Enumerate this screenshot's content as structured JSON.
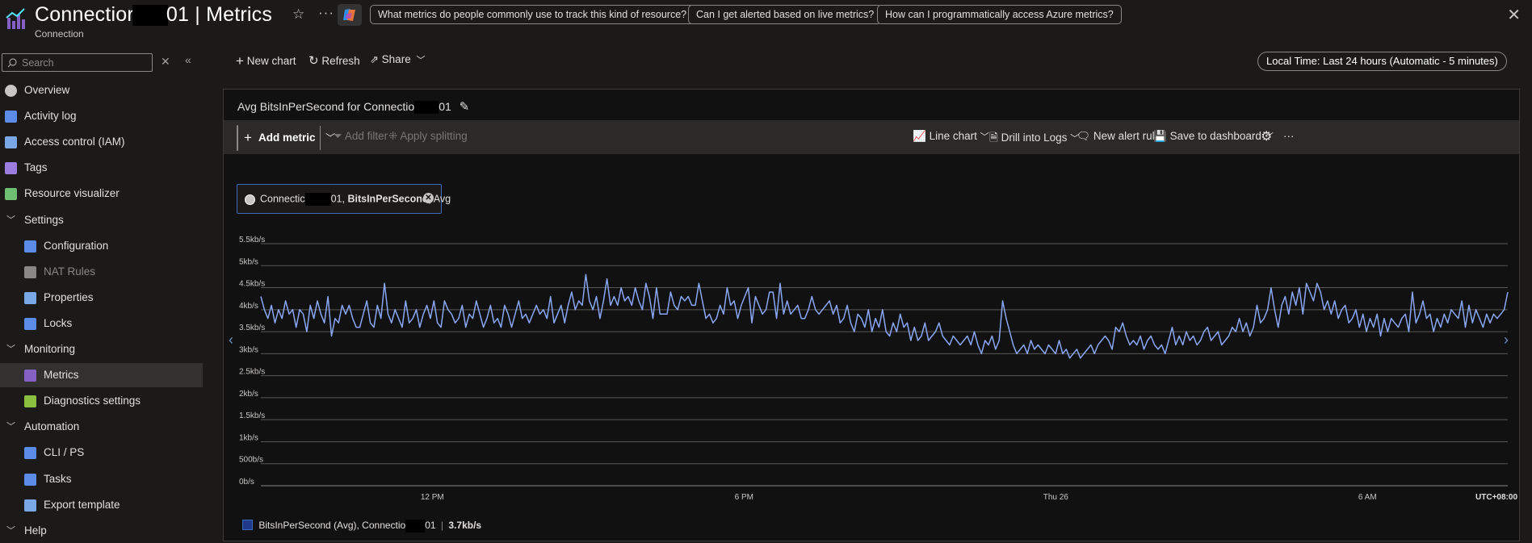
{
  "header": {
    "title_left": "Connectior",
    "title_right": "01 | Metrics",
    "subtitle": "Connection",
    "suggestions": [
      "What metrics do people commonly use to track this kind of resource?",
      "Can I get alerted based on live metrics?",
      "How can I programmatically access Azure metrics?"
    ]
  },
  "sidebar": {
    "search_placeholder": "Search",
    "items": [
      {
        "label": "Overview",
        "icon": "overview-icon",
        "level": 0
      },
      {
        "label": "Activity log",
        "icon": "activity-log-icon",
        "level": 0
      },
      {
        "label": "Access control (IAM)",
        "icon": "iam-icon",
        "level": 0
      },
      {
        "label": "Tags",
        "icon": "tag-icon",
        "level": 0
      },
      {
        "label": "Resource visualizer",
        "icon": "visualizer-icon",
        "level": 0
      },
      {
        "label": "Settings",
        "icon": "chevron-down-icon",
        "level": 0,
        "group": true
      },
      {
        "label": "Configuration",
        "icon": "configuration-icon",
        "level": 1
      },
      {
        "label": "NAT Rules",
        "icon": "nat-icon",
        "level": 1,
        "disabled": true
      },
      {
        "label": "Properties",
        "icon": "properties-icon",
        "level": 1
      },
      {
        "label": "Locks",
        "icon": "lock-icon",
        "level": 1
      },
      {
        "label": "Monitoring",
        "icon": "chevron-down-icon",
        "level": 0,
        "group": true
      },
      {
        "label": "Metrics",
        "icon": "metrics-icon",
        "level": 1,
        "selected": true
      },
      {
        "label": "Diagnostics settings",
        "icon": "diagnostics-icon",
        "level": 1
      },
      {
        "label": "Automation",
        "icon": "chevron-down-icon",
        "level": 0,
        "group": true
      },
      {
        "label": "CLI / PS",
        "icon": "cli-icon",
        "level": 1
      },
      {
        "label": "Tasks",
        "icon": "tasks-icon",
        "level": 1
      },
      {
        "label": "Export template",
        "icon": "export-icon",
        "level": 1
      },
      {
        "label": "Help",
        "icon": "chevron-down-icon",
        "level": 0,
        "group": true
      }
    ]
  },
  "toolbar": {
    "new_chart": "New chart",
    "refresh": "Refresh",
    "share": "Share",
    "time_range": "Local Time: Last 24 hours (Automatic - 5 minutes)"
  },
  "panel": {
    "title_left": "Avg BitsInPerSecond for Connectio",
    "title_right": "01",
    "add_metric": "Add metric",
    "add_filter": "Add filter",
    "apply_splitting": "Apply splitting",
    "line_chart": "Line chart",
    "drill_logs": "Drill into Logs",
    "new_alert": "New alert rule",
    "save_dashboard": "Save to dashboard",
    "pill_prefix": "Connectic",
    "pill_suffix": "01,",
    "pill_metric": "BitsInPerSecond,",
    "pill_agg": "Avg",
    "legend_prefix": "BitsInPerSecond (Avg), Connectio",
    "legend_suffix": "01",
    "legend_value": "3.7kb/s"
  },
  "chart_data": {
    "type": "line",
    "ylabel_ticks": [
      "0b/s",
      "500b/s",
      "1kb/s",
      "1.5kb/s",
      "2kb/s",
      "2.5kb/s",
      "3kb/s",
      "3.5kb/s",
      "4kb/s",
      "4.5kb/s",
      "5kb/s",
      "5.5kb/s"
    ],
    "ylim": [
      0,
      5500
    ],
    "y_unit": "b/s",
    "x_ticks": [
      "12 PM",
      "6 PM",
      "Thu 26",
      "6 AM"
    ],
    "x_tick_hours": [
      3.3,
      9.3,
      15.3,
      21.3
    ],
    "timezone_label": "UTC+08:00",
    "series": [
      {
        "name": "BitsInPerSecond (Avg)",
        "color": "#8aa7f5",
        "interval_minutes": 5,
        "values": [
          4300,
          4000,
          3800,
          4100,
          3700,
          4000,
          3800,
          4200,
          3900,
          4000,
          3600,
          4000,
          3900,
          3500,
          4100,
          3800,
          4200,
          3900,
          3700,
          4300,
          3400,
          3800,
          3700,
          4100,
          3900,
          4100,
          3800,
          3600,
          3600,
          3900,
          4200,
          3700,
          3600,
          4100,
          3800,
          4600,
          3900,
          3700,
          4000,
          3800,
          3600,
          4200,
          3700,
          3800,
          4000,
          3600,
          3900,
          4100,
          3800,
          4200,
          3700,
          3600,
          4200,
          4000,
          3900,
          3700,
          3800,
          4100,
          3600,
          3900,
          3800,
          4200,
          3900,
          3600,
          3800,
          4100,
          3700,
          3800,
          3600,
          4100,
          3900,
          3600,
          3900,
          4200,
          3800,
          3900,
          3700,
          3900,
          4100,
          3900,
          4000,
          3800,
          4300,
          3700,
          3900,
          4100,
          3700,
          4100,
          4400,
          4000,
          4200,
          4100,
          4800,
          4200,
          4000,
          4300,
          3800,
          4200,
          4700,
          4100,
          4300,
          4100,
          4500,
          4200,
          4300,
          4100,
          4500,
          4200,
          4000,
          4600,
          4300,
          3800,
          4500,
          3900,
          3900,
          3900,
          4400,
          4100,
          4000,
          4300,
          4200,
          4300,
          4100,
          4100,
          4600,
          4200,
          3800,
          3900,
          3700,
          3800,
          4100,
          3900,
          4500,
          4100,
          4200,
          3800,
          4100,
          4300,
          4500,
          3700,
          4300,
          4100,
          3900,
          4000,
          4400,
          4400,
          3800,
          4600,
          3900,
          4200,
          3900,
          4000,
          4100,
          3800,
          3800,
          4000,
          4300,
          4000,
          3900,
          4000,
          4100,
          4200,
          3900,
          4100,
          3700,
          3800,
          4100,
          3700,
          3500,
          3900,
          3800,
          3600,
          4000,
          3500,
          3800,
          3600,
          4000,
          3500,
          3400,
          3700,
          3500,
          3900,
          3600,
          3700,
          3300,
          3600,
          3300,
          3400,
          3700,
          3300,
          3400,
          3500,
          3700,
          3400,
          3300,
          3200,
          3400,
          3300,
          3200,
          3300,
          3400,
          3200,
          3500,
          3200,
          3000,
          3300,
          3200,
          3400,
          3100,
          3300,
          4200,
          3800,
          3500,
          3200,
          3000,
          3100,
          3200,
          3000,
          3300,
          3100,
          3200,
          3100,
          3000,
          3200,
          3100,
          3000,
          3300,
          3000,
          3100,
          2900,
          3000,
          3100,
          2900,
          3000,
          3100,
          3200,
          3000,
          3200,
          3300,
          3400,
          3300,
          3100,
          3600,
          3500,
          3700,
          3400,
          3200,
          3300,
          3200,
          3400,
          3100,
          3300,
          3400,
          3200,
          3100,
          3200,
          3000,
          3300,
          3600,
          3200,
          3400,
          3200,
          3500,
          3300,
          3400,
          3200,
          3300,
          3500,
          3600,
          3300,
          3400,
          3500,
          3200,
          3300,
          3400,
          3600,
          3500,
          3800,
          3500,
          3700,
          3400,
          3600,
          4100,
          3700,
          3800,
          4000,
          4500,
          4000,
          3600,
          4100,
          4300,
          3900,
          4400,
          4100,
          4500,
          3900,
          4600,
          4400,
          4200,
          4600,
          4400,
          4000,
          4200,
          3900,
          4200,
          3800,
          4000,
          4100,
          3700,
          3800,
          4000,
          3600,
          3900,
          3500,
          3800,
          3600,
          3900,
          3400,
          3800,
          3500,
          3800,
          3700,
          3600,
          3800,
          3900,
          3500,
          4400,
          3700,
          3900,
          4200,
          3800,
          3900,
          3500,
          3800,
          3600,
          3900,
          3700,
          4000,
          3900,
          3800,
          4200,
          3600,
          4100,
          3700,
          4000,
          3800,
          3600,
          3900,
          3700,
          3900,
          3800,
          3900,
          4000,
          4400
        ]
      }
    ]
  }
}
